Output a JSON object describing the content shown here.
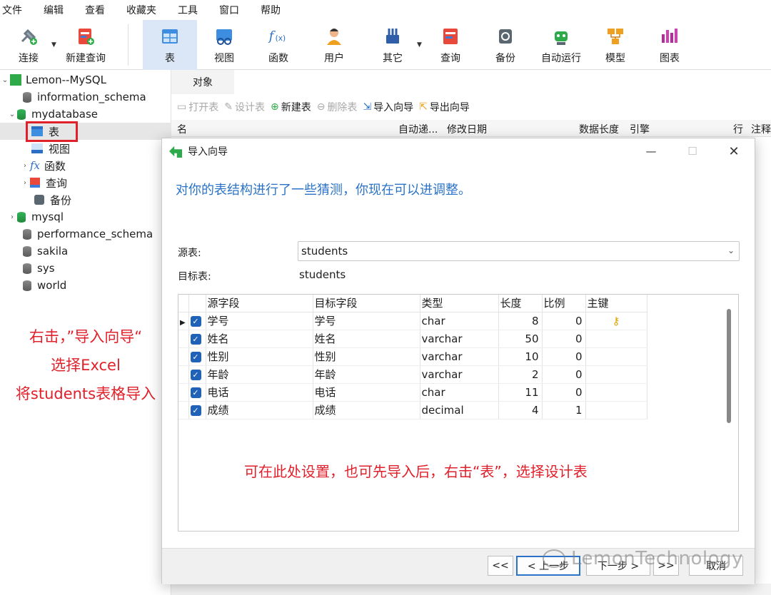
{
  "menubar": [
    "文件",
    "编辑",
    "查看",
    "收藏夹",
    "工具",
    "窗口",
    "帮助"
  ],
  "toolbar": {
    "connect": "连接",
    "new_query": "新建查询",
    "table": "表",
    "view": "视图",
    "function": "函数",
    "user": "用户",
    "other": "其它",
    "query": "查询",
    "backup": "备份",
    "automation": "自动运行",
    "model": "模型",
    "chart": "图表"
  },
  "sidebar": {
    "connection": "Lemon--MySQL",
    "databases": [
      "information_schema",
      "mydatabase",
      "mysql",
      "performance_schema",
      "sakila",
      "sys",
      "world"
    ],
    "mydatabase_children": [
      "表",
      "视图",
      "函数",
      "查询",
      "备份"
    ]
  },
  "annotation_left": {
    "line1": "右击，”导入向导“",
    "line2": "选择Excel",
    "line3": "将students表格导入"
  },
  "tabs": {
    "objects": "对象"
  },
  "object_toolbar": {
    "open_table": "打开表",
    "design_table": "设计表",
    "new_table": "新建表",
    "delete_table": "删除表",
    "import_wizard": "导入向导",
    "export_wizard": "导出向导"
  },
  "list_header": {
    "name": "名",
    "auto_inc": "自动递...",
    "modified": "修改日期",
    "data_length": "数据长度",
    "engine": "引擎",
    "rows": "行",
    "comment": "注释"
  },
  "dialog": {
    "title": "导入向导",
    "hint": "对你的表结构进行了一些猜测，你现在可以进调整。",
    "source_label": "源表:",
    "source_value": "students",
    "target_label": "目标表:",
    "target_value": "students",
    "columns": [
      "源字段",
      "目标字段",
      "类型",
      "长度",
      "比例",
      "主键"
    ],
    "rows": [
      {
        "src": "学号",
        "dst": "学号",
        "type": "char",
        "len": "8",
        "scale": "0",
        "pk": true
      },
      {
        "src": "姓名",
        "dst": "姓名",
        "type": "varchar",
        "len": "50",
        "scale": "0",
        "pk": false
      },
      {
        "src": "性别",
        "dst": "性别",
        "type": "varchar",
        "len": "10",
        "scale": "0",
        "pk": false
      },
      {
        "src": "年龄",
        "dst": "年龄",
        "type": "varchar",
        "len": "2",
        "scale": "0",
        "pk": false
      },
      {
        "src": "电话",
        "dst": "电话",
        "type": "char",
        "len": "11",
        "scale": "0",
        "pk": false
      },
      {
        "src": "成绩",
        "dst": "成绩",
        "type": "decimal",
        "len": "4",
        "scale": "1",
        "pk": false
      }
    ],
    "note": "可在此处设置，也可先导入后，右击“表”，选择设计表",
    "buttons": {
      "first": "<<",
      "back": "< 上一步",
      "next": "下一步 >",
      "last": ">>",
      "cancel": "取消"
    }
  },
  "watermark": "LemonTechnology",
  "colors": {
    "accent": "#2b73c9",
    "annotation": "#e0202a",
    "selected_tool": "#dbe7f6"
  }
}
